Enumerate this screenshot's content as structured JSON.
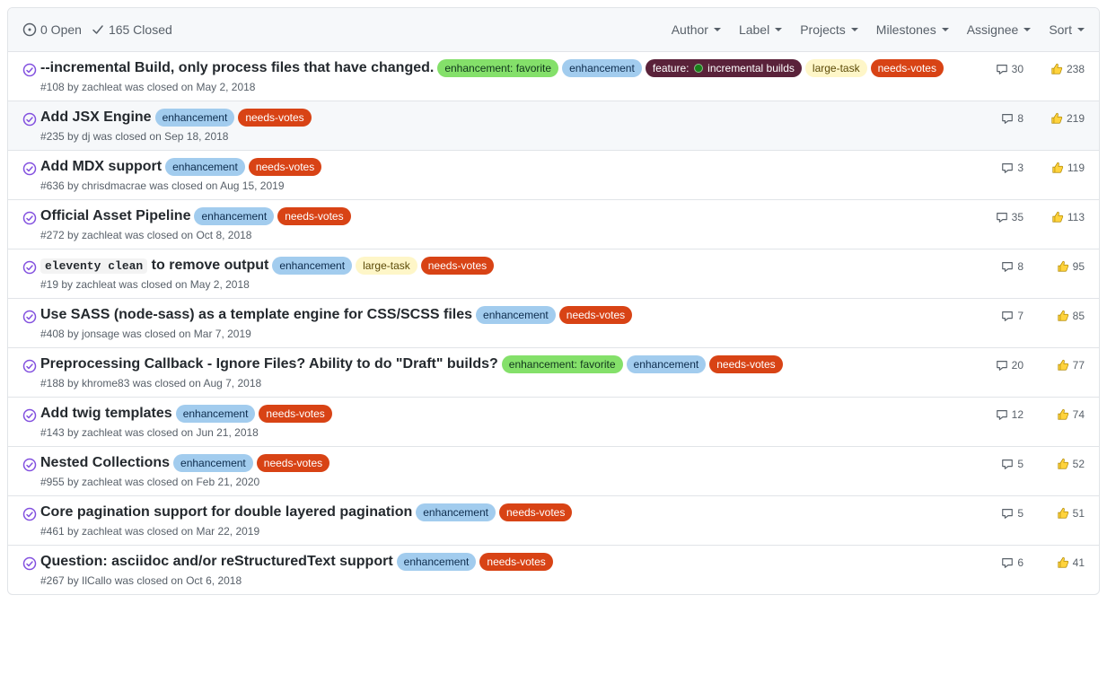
{
  "header": {
    "open_count": "0 Open",
    "closed_count": "165 Closed",
    "filters": [
      "Author",
      "Label",
      "Projects",
      "Milestones",
      "Assignee",
      "Sort"
    ]
  },
  "label_styles": {
    "enhancement-favorite": {
      "bg": "#84e06a",
      "fg": "#10361c"
    },
    "enhancement": {
      "bg": "#a2ccee",
      "fg": "#0d2c4d"
    },
    "feature-incremental": {
      "bg": "#5a223a",
      "fg": "#ffffff"
    },
    "large-task": {
      "bg": "#fef6c8",
      "fg": "#5c4b07"
    },
    "needs-votes": {
      "bg": "#d84315",
      "fg": "#ffffff"
    }
  },
  "issues": [
    {
      "title": "--incremental Build, only process files that have changed.",
      "labels": [
        {
          "text": "enhancement: favorite",
          "style": "enhancement-favorite"
        },
        {
          "text": "enhancement",
          "style": "enhancement"
        },
        {
          "text": "feature: ",
          "suffix": " incremental builds",
          "style": "feature-incremental",
          "dot": true
        },
        {
          "text": "large-task",
          "style": "large-task"
        },
        {
          "text": "needs-votes",
          "style": "needs-votes"
        }
      ],
      "meta": "#108 by zachleat was closed on May 2, 2018",
      "comments": "30",
      "reactions": "238",
      "highlight": false
    },
    {
      "title": "Add JSX Engine",
      "labels": [
        {
          "text": "enhancement",
          "style": "enhancement"
        },
        {
          "text": "needs-votes",
          "style": "needs-votes"
        }
      ],
      "meta": "#235 by dj was closed on Sep 18, 2018",
      "comments": "8",
      "reactions": "219",
      "highlight": true
    },
    {
      "title": "Add MDX support",
      "labels": [
        {
          "text": "enhancement",
          "style": "enhancement"
        },
        {
          "text": "needs-votes",
          "style": "needs-votes"
        }
      ],
      "meta": "#636 by chrisdmacrae was closed on Aug 15, 2019",
      "comments": "3",
      "reactions": "119",
      "highlight": false
    },
    {
      "title": "Official Asset Pipeline",
      "labels": [
        {
          "text": "enhancement",
          "style": "enhancement"
        },
        {
          "text": "needs-votes",
          "style": "needs-votes"
        }
      ],
      "meta": "#272 by zachleat was closed on Oct 8, 2018",
      "comments": "35",
      "reactions": "113",
      "highlight": false
    },
    {
      "title_parts": [
        {
          "code": "eleventy clean"
        },
        {
          "text": " to remove output"
        }
      ],
      "labels": [
        {
          "text": "enhancement",
          "style": "enhancement"
        },
        {
          "text": "large-task",
          "style": "large-task"
        },
        {
          "text": "needs-votes",
          "style": "needs-votes"
        }
      ],
      "meta": "#19 by zachleat was closed on May 2, 2018",
      "comments": "8",
      "reactions": "95",
      "highlight": false
    },
    {
      "title": "Use SASS (node-sass) as a template engine for CSS/SCSS files",
      "labels": [
        {
          "text": "enhancement",
          "style": "enhancement"
        },
        {
          "text": "needs-votes",
          "style": "needs-votes"
        }
      ],
      "meta": "#408 by jonsage was closed on Mar 7, 2019",
      "comments": "7",
      "reactions": "85",
      "highlight": false
    },
    {
      "title": "Preprocessing Callback - Ignore Files? Ability to do \"Draft\" builds?",
      "labels": [
        {
          "text": "enhancement: favorite",
          "style": "enhancement-favorite"
        },
        {
          "text": "enhancement",
          "style": "enhancement"
        },
        {
          "text": "needs-votes",
          "style": "needs-votes"
        }
      ],
      "meta": "#188 by khrome83 was closed on Aug 7, 2018",
      "comments": "20",
      "reactions": "77",
      "highlight": false
    },
    {
      "title": "Add twig templates",
      "labels": [
        {
          "text": "enhancement",
          "style": "enhancement"
        },
        {
          "text": "needs-votes",
          "style": "needs-votes"
        }
      ],
      "meta": "#143 by zachleat was closed on Jun 21, 2018",
      "comments": "12",
      "reactions": "74",
      "highlight": false
    },
    {
      "title": "Nested Collections",
      "labels": [
        {
          "text": "enhancement",
          "style": "enhancement"
        },
        {
          "text": "needs-votes",
          "style": "needs-votes"
        }
      ],
      "meta": "#955 by zachleat was closed on Feb 21, 2020",
      "comments": "5",
      "reactions": "52",
      "highlight": false
    },
    {
      "title": "Core pagination support for double layered pagination",
      "labels": [
        {
          "text": "enhancement",
          "style": "enhancement"
        },
        {
          "text": "needs-votes",
          "style": "needs-votes"
        }
      ],
      "meta": "#461 by zachleat was closed on Mar 22, 2019",
      "comments": "5",
      "reactions": "51",
      "highlight": false
    },
    {
      "title": "Question: asciidoc and/or reStructuredText support",
      "labels": [
        {
          "text": "enhancement",
          "style": "enhancement"
        },
        {
          "text": "needs-votes",
          "style": "needs-votes"
        }
      ],
      "meta": "#267 by IlCallo was closed on Oct 6, 2018",
      "comments": "6",
      "reactions": "41",
      "highlight": false
    }
  ]
}
